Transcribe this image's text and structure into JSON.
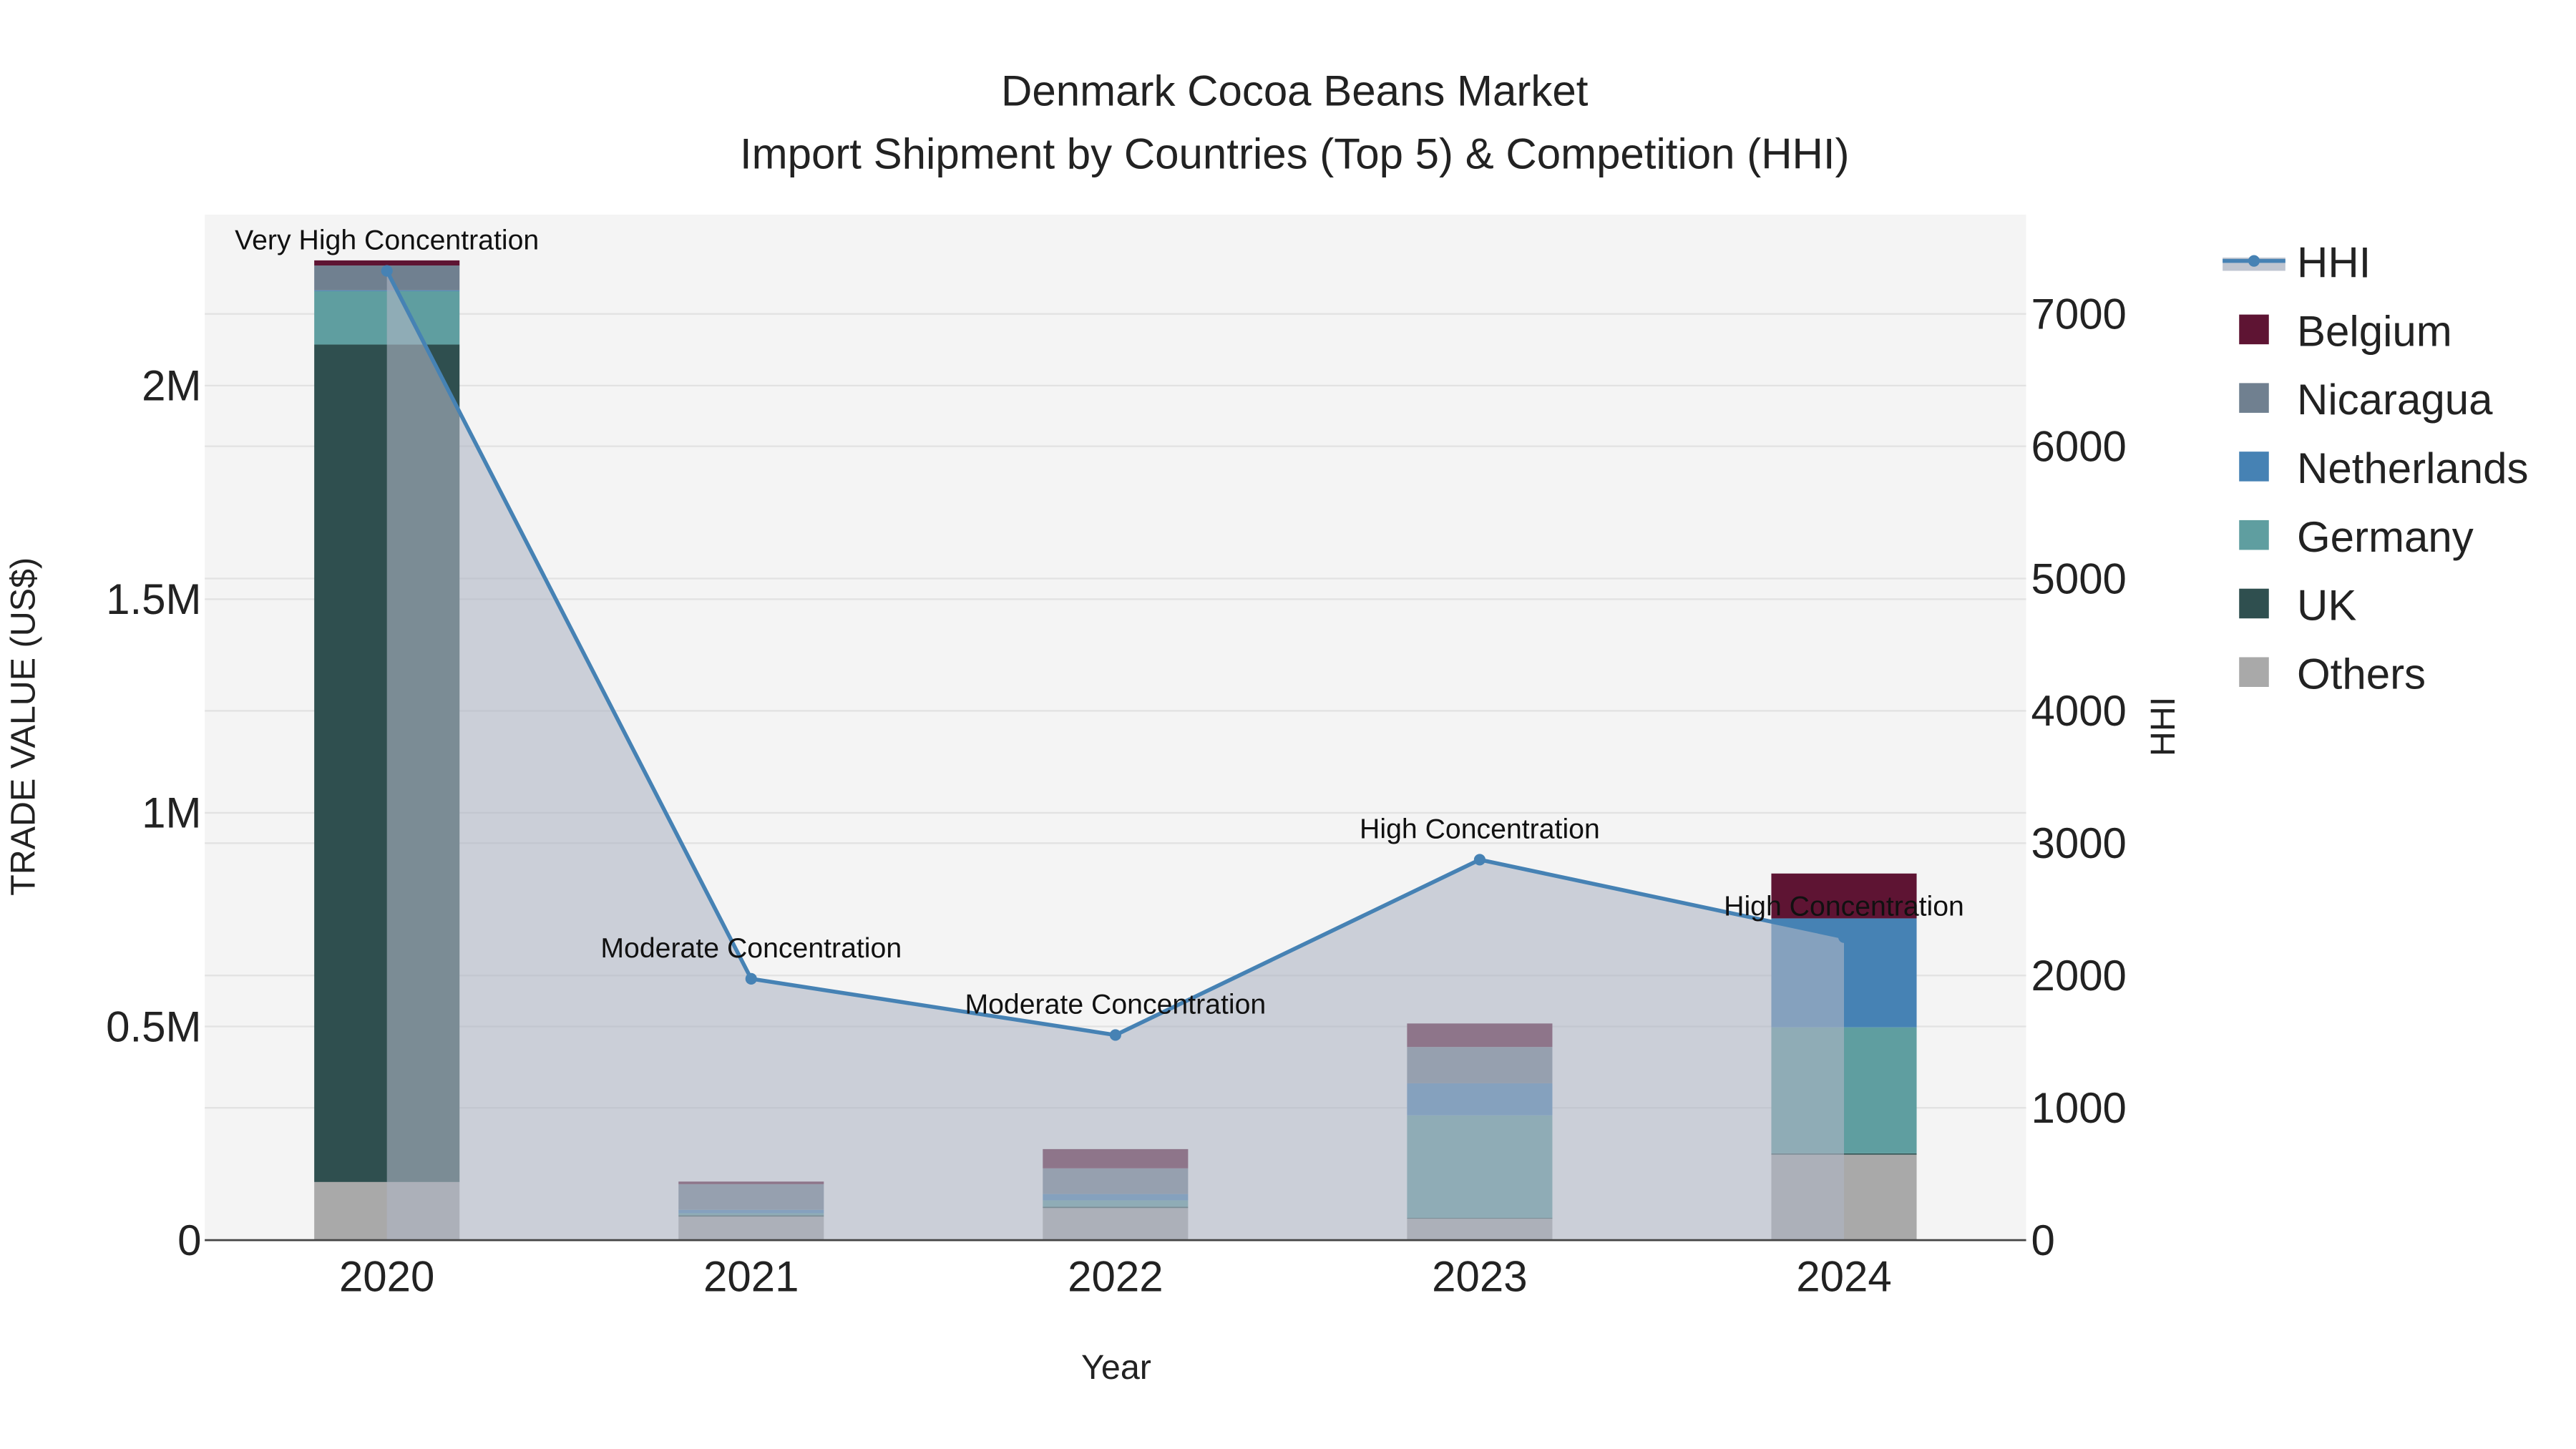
{
  "chart_data": {
    "type": "bar",
    "title": "Denmark Cocoa Beans Market",
    "subtitle": "Import Shipment by Countries (Top 5) & Competition (HHI)",
    "xlabel": "Year",
    "ylabel": "TRADE VALUE (US$)",
    "y2label": "HHI",
    "categories": [
      "2020",
      "2021",
      "2022",
      "2023",
      "2024"
    ],
    "ylim": [
      0,
      2400000
    ],
    "y2lim": [
      0,
      7750
    ],
    "yticks": [
      0,
      500000,
      1000000,
      1500000,
      2000000
    ],
    "ytick_labels": [
      "0",
      "0.5M",
      "1M",
      "1.5M",
      "2M"
    ],
    "y2ticks": [
      0,
      1000,
      2000,
      3000,
      4000,
      5000,
      6000,
      7000
    ],
    "y2tick_labels": [
      "0",
      "1000",
      "2000",
      "3000",
      "4000",
      "5000",
      "6000",
      "7000"
    ],
    "grid": true,
    "legend_position": "right",
    "series": [
      {
        "name": "Others",
        "color": "#a9a9a9",
        "values": [
          136000,
          55000,
          75000,
          50000,
          200000
        ]
      },
      {
        "name": "UK",
        "color": "#2f4f4f",
        "values": [
          1960000,
          3000,
          3000,
          2000,
          3000
        ]
      },
      {
        "name": "Germany",
        "color": "#5f9ea0",
        "values": [
          125000,
          5000,
          15000,
          240000,
          295000
        ]
      },
      {
        "name": "Netherlands",
        "color": "#4682b4",
        "values": [
          2000,
          8000,
          15000,
          75000,
          255000
        ]
      },
      {
        "name": "Nicaragua",
        "color": "#708090",
        "values": [
          58000,
          60000,
          60000,
          85000,
          0
        ]
      },
      {
        "name": "Belgium",
        "color": "#5e1433",
        "values": [
          12000,
          6000,
          45000,
          55000,
          105000
        ]
      }
    ],
    "line": {
      "name": "HHI",
      "color": "#4682b4",
      "values": [
        7325,
        1975,
        1550,
        2875,
        2290
      ],
      "annotations": [
        "Very High Concentration",
        "Moderate Concentration",
        "Moderate Concentration",
        "High Concentration",
        "High Concentration"
      ]
    },
    "legend_order": [
      "HHI",
      "Belgium",
      "Nicaragua",
      "Netherlands",
      "Germany",
      "UK",
      "Others"
    ]
  }
}
